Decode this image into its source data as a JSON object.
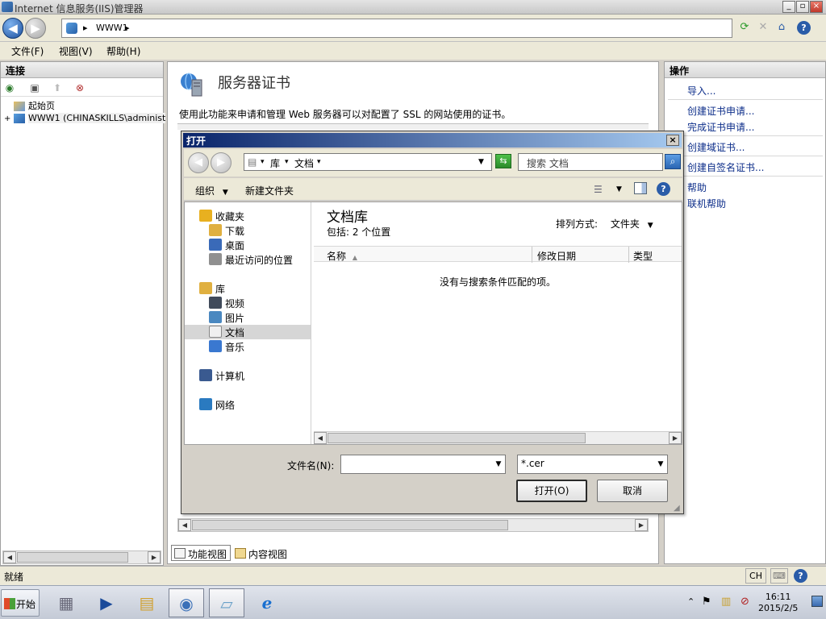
{
  "window": {
    "title": "Internet 信息服务(IIS)管理器",
    "min": "_",
    "max": "▫",
    "close": "×"
  },
  "nav": {
    "back": "◀",
    "forward": "▶",
    "path_segment": "WWW1",
    "sep": "▸",
    "refresh": "⟳",
    "stop": "✕",
    "home": "⌂",
    "help": "?"
  },
  "menu": {
    "file": "文件(F)",
    "view": "视图(V)",
    "help": "帮助(H)"
  },
  "connections": {
    "header": "连接",
    "tree": [
      {
        "label": "起始页",
        "expander": ""
      },
      {
        "label": "WWW1 (CHINASKILLS\\administ",
        "expander": "+"
      }
    ]
  },
  "center": {
    "title": "服务器证书",
    "description": "使用此功能来申请和管理 Web 服务器可以对配置了 SSL 的网站使用的证书。",
    "tabs": [
      {
        "label": "功能视图",
        "selected": true
      },
      {
        "label": "内容视图",
        "selected": false
      }
    ]
  },
  "actions": {
    "header": "操作",
    "items": [
      {
        "label": "导入..."
      },
      {
        "label": "创建证书申请..."
      },
      {
        "label": "完成证书申请..."
      },
      {
        "label": "创建域证书..."
      },
      {
        "label": "创建自签名证书..."
      },
      {
        "label": "帮助"
      },
      {
        "label": "联机帮助"
      }
    ]
  },
  "status": {
    "text": "就绪",
    "lang": "CH"
  },
  "taskbar": {
    "start": "开始",
    "clock_time": "16:11",
    "clock_date": "2015/2/5"
  },
  "dialog": {
    "title": "打开",
    "close": "×",
    "path": [
      "库",
      "文档"
    ],
    "search_placeholder": "搜索 文档",
    "toolbar": {
      "organize": "组织",
      "new_folder": "新建文件夹"
    },
    "nav_pane": [
      {
        "label": "收藏夹",
        "level": 0,
        "icon": "star-icon",
        "color": "#e8b020"
      },
      {
        "label": "下载",
        "level": 1,
        "icon": "download-folder-icon",
        "color": "#e0b040"
      },
      {
        "label": "桌面",
        "level": 1,
        "icon": "desktop-icon",
        "color": "#3a6ab8"
      },
      {
        "label": "最近访问的位置",
        "level": 1,
        "icon": "recent-places-icon",
        "color": "#909090"
      },
      {
        "label": "",
        "level": -1
      },
      {
        "label": "库",
        "level": 0,
        "icon": "library-icon",
        "color": "#e0b040"
      },
      {
        "label": "视频",
        "level": 1,
        "icon": "video-icon",
        "color": "#404a5a"
      },
      {
        "label": "图片",
        "level": 1,
        "icon": "pictures-icon",
        "color": "#4a88c0"
      },
      {
        "label": "文档",
        "level": 1,
        "icon": "documents-icon",
        "color": "#f0f0f0",
        "selected": true
      },
      {
        "label": "音乐",
        "level": 1,
        "icon": "music-icon",
        "color": "#3a78d0"
      },
      {
        "label": "",
        "level": -1
      },
      {
        "label": "计算机",
        "level": 0,
        "icon": "computer-icon",
        "color": "#3a5a90"
      },
      {
        "label": "",
        "level": -1
      },
      {
        "label": "网络",
        "level": 0,
        "icon": "network-icon",
        "color": "#2a7ac0"
      }
    ],
    "library_title": "文档库",
    "includes": "包括: 2 个位置",
    "arrange_label": "排列方式:",
    "arrange_value": "文件夹",
    "columns": [
      "名称",
      "修改日期",
      "类型"
    ],
    "empty_message": "没有与搜索条件匹配的项。",
    "filename_label": "文件名(N):",
    "filename_value": "",
    "filetype": "*.cer",
    "open_button": "打开(O)",
    "cancel_button": "取消"
  }
}
